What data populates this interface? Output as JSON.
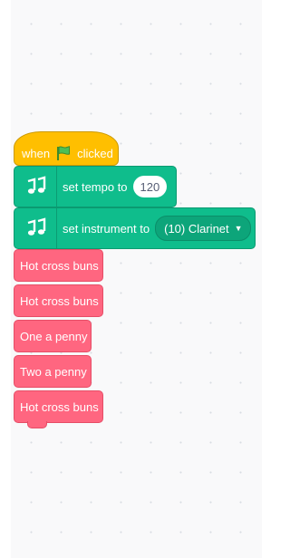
{
  "event_block": {
    "prefix": "when",
    "icon": "green-flag-icon",
    "suffix": "clicked",
    "color": "#ffbf00"
  },
  "music": {
    "color": "#0fbd8c",
    "icon": "music-notes-icon",
    "tempo_label": "set tempo to",
    "tempo_value": "120",
    "instrument_label": "set instrument to",
    "instrument_value": "(10) Clarinet"
  },
  "procedures": {
    "color": "#ff6680",
    "items": [
      {
        "label": "Hot cross buns"
      },
      {
        "label": "Hot cross buns"
      },
      {
        "label": "One a penny"
      },
      {
        "label": "Two a penny"
      },
      {
        "label": "Hot cross buns"
      }
    ]
  }
}
